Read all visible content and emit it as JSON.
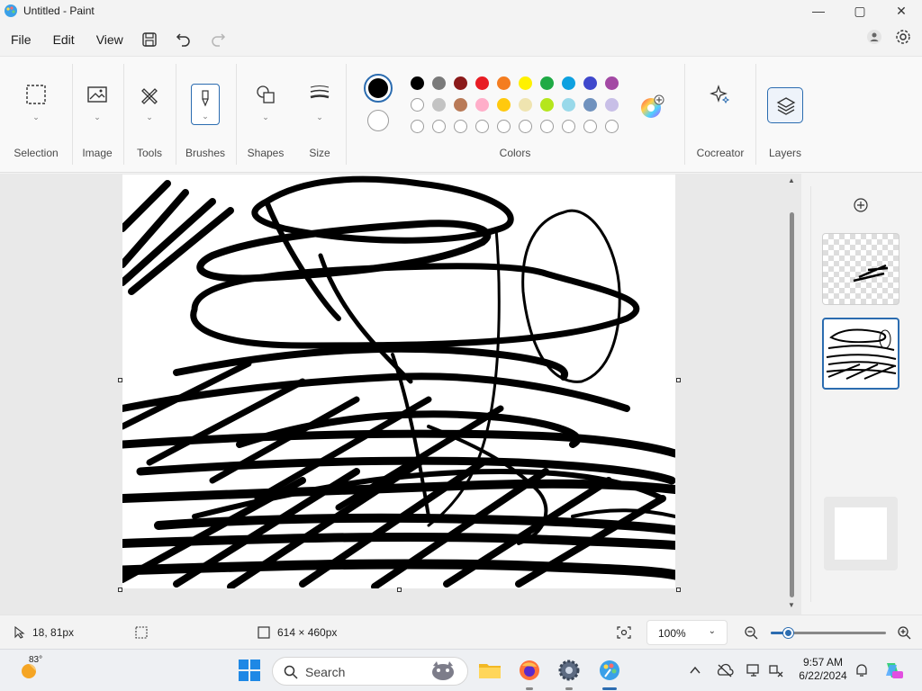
{
  "window": {
    "title": "Untitled - Paint",
    "controls": {
      "minimize": "—",
      "maximize": "▢",
      "close": "✕"
    }
  },
  "menu": {
    "items": [
      "File",
      "Edit",
      "View"
    ],
    "icons": [
      "save-icon",
      "undo-icon",
      "redo-icon"
    ],
    "right_icons": [
      "account-icon",
      "settings-icon"
    ]
  },
  "ribbon": {
    "groups": {
      "selection": "Selection",
      "image": "Image",
      "tools": "Tools",
      "brushes": "Brushes",
      "shapes": "Shapes",
      "size": "Size",
      "colors": "Colors",
      "cocreator": "Cocreator",
      "layers": "Layers"
    },
    "primary_color": "#000000",
    "secondary_color": "#ffffff",
    "palette_row1": [
      "#000000",
      "#7a7a7a",
      "#8b1a1a",
      "#e81c24",
      "#f47d20",
      "#fff100",
      "#1faa45",
      "#0ea1e0",
      "#3f48cc",
      "#a349a4"
    ],
    "palette_row2": [
      "#ffffff",
      "#c3c3c3",
      "#b97a57",
      "#ffaec9",
      "#ffc90e",
      "#efe4b0",
      "#b5e61d",
      "#99d9ea",
      "#7092be",
      "#c8bfe7"
    ],
    "palette_row3_count": 10
  },
  "canvas": {
    "background": "#ffffff",
    "stroke_color": "#000000"
  },
  "layers_panel": {
    "add_icon": "add-layer-icon",
    "layers": [
      "layer-1",
      "layer-2"
    ]
  },
  "status": {
    "cursor_position": "18, 81px",
    "selection_size": "",
    "canvas_size": "614 × 460px",
    "zoom": "100%"
  },
  "taskbar": {
    "weather_temp": "83°",
    "search_placeholder": "Search",
    "time": "9:57 AM",
    "date": "6/22/2024",
    "apps": [
      "start-icon",
      "file-explorer-icon",
      "firefox-icon",
      "settings-app-icon",
      "paint-app-icon"
    ],
    "tray": [
      "chevron-up-icon",
      "onedrive-icon",
      "display-icon",
      "network-icon",
      "notification-icon",
      "copilot-icon"
    ]
  }
}
